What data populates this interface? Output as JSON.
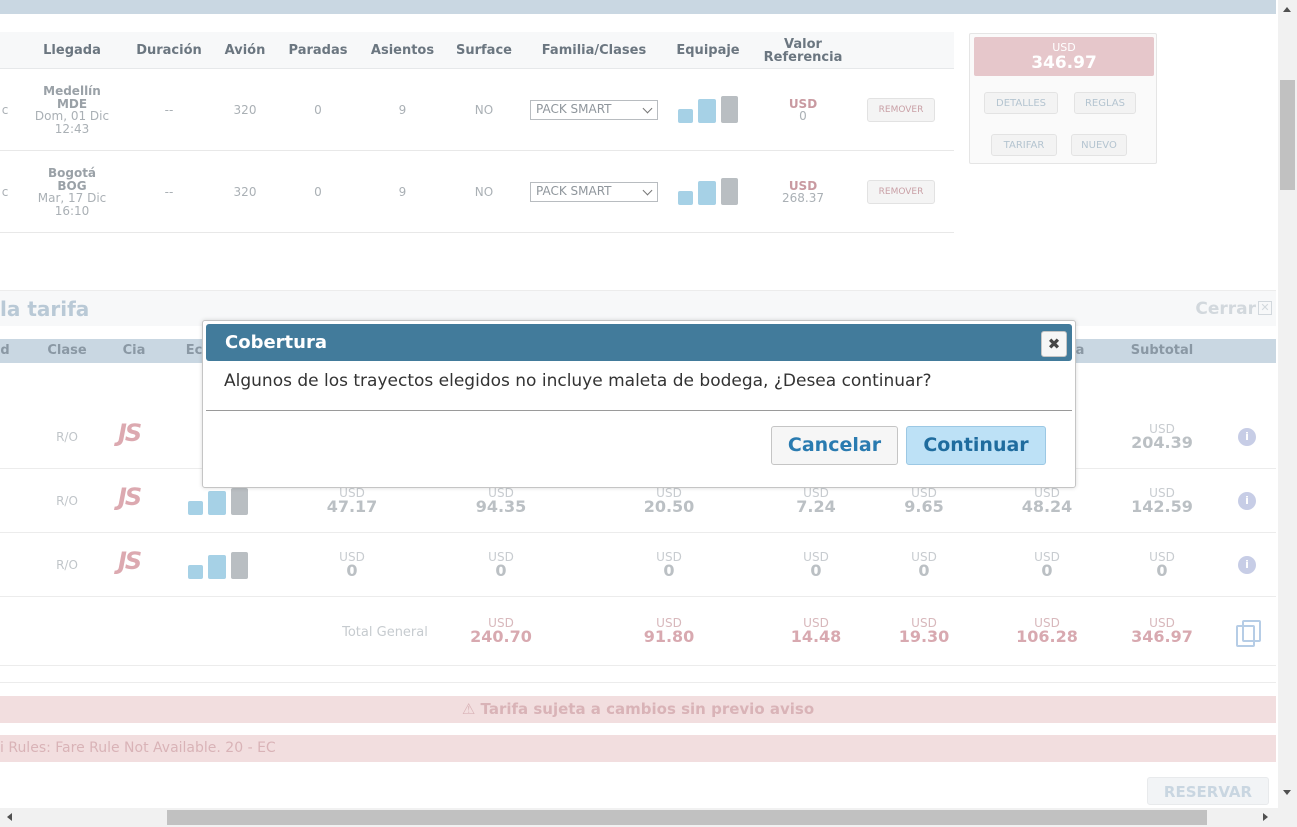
{
  "segments_table": {
    "headers": [
      "Llegada",
      "Duración",
      "Avión",
      "Paradas",
      "Asientos",
      "Surface",
      "Familia/Clases",
      "Equipaje",
      "Valor Referencia"
    ],
    "rows": [
      {
        "prev_fragment": "c",
        "city": "Medellín",
        "code": "MDE",
        "date": "Dom, 01 Dic",
        "time": "12:43",
        "duracion": "--",
        "avion": "320",
        "paradas": "0",
        "asientos": "9",
        "surface": "NO",
        "familia": "PACK SMART",
        "currency": "USD",
        "valor": "0",
        "remove_label": "REMOVER"
      },
      {
        "prev_fragment": "c",
        "city": "Bogotá",
        "code": "BOG",
        "date": "Mar, 17 Dic",
        "time": "16:10",
        "duracion": "--",
        "avion": "320",
        "paradas": "0",
        "asientos": "9",
        "surface": "NO",
        "familia": "PACK SMART",
        "currency": "USD",
        "valor": "268.37",
        "remove_label": "REMOVER"
      }
    ]
  },
  "sidebox": {
    "currency": "USD",
    "total": "346.97",
    "detalles_label": "DETALLES",
    "reglas_label": "REGLAS",
    "tarifar_label": "TARIFAR",
    "nuevo_label": "NUEVO"
  },
  "fare_section": {
    "title": "la tarifa",
    "close_label": "Cerrar",
    "headers": {
      "d": "d",
      "clase": "Clase",
      "cia": "Cia",
      "eq": "Ec",
      "a": "a",
      "subtotal": "Subtotal"
    },
    "rows": [
      {
        "clase": "R/O",
        "cia": "JS",
        "vals": [],
        "subtotal": "204.39"
      },
      {
        "clase": "R/O",
        "cia": "JS",
        "vals": [
          "47.17",
          "94.35",
          "20.50",
          "7.24",
          "9.65",
          "48.24"
        ],
        "subtotal": "142.59"
      },
      {
        "clase": "R/O",
        "cia": "JS",
        "vals": [
          "0",
          "0",
          "0",
          "0",
          "0",
          "0"
        ],
        "subtotal": "0"
      }
    ],
    "currency": "USD",
    "total_label": "Total General",
    "totals": [
      "240.70",
      "91.80",
      "14.48",
      "19.30",
      "106.28",
      "346.97"
    ]
  },
  "alert": {
    "text": "⚠ Tarifa sujeta a cambios sin previo aviso"
  },
  "rules": {
    "text": "i Rules: Fare Rule Not Available. 20 - EC"
  },
  "reservar_label": "RESERVAR",
  "modal": {
    "title": "Cobertura",
    "message": "Algunos de los trayectos elegidos no incluye maleta de bodega, ¿Desea continuar?",
    "cancel_label": "Cancelar",
    "continue_label": "Continuar",
    "close_glyph": "✖"
  }
}
